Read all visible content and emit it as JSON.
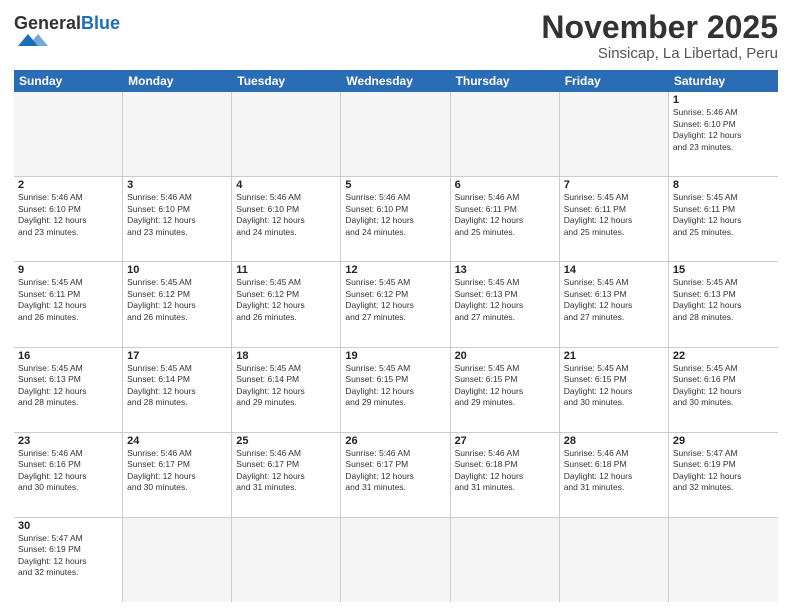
{
  "header": {
    "logo_general": "General",
    "logo_blue": "Blue",
    "month_title": "November 2025",
    "location": "Sinsicap, La Libertad, Peru"
  },
  "weekdays": [
    "Sunday",
    "Monday",
    "Tuesday",
    "Wednesday",
    "Thursday",
    "Friday",
    "Saturday"
  ],
  "weeks": [
    [
      {
        "day": "",
        "info": ""
      },
      {
        "day": "",
        "info": ""
      },
      {
        "day": "",
        "info": ""
      },
      {
        "day": "",
        "info": ""
      },
      {
        "day": "",
        "info": ""
      },
      {
        "day": "",
        "info": ""
      },
      {
        "day": "1",
        "info": "Sunrise: 5:46 AM\nSunset: 6:10 PM\nDaylight: 12 hours\nand 23 minutes."
      }
    ],
    [
      {
        "day": "2",
        "info": "Sunrise: 5:46 AM\nSunset: 6:10 PM\nDaylight: 12 hours\nand 23 minutes."
      },
      {
        "day": "3",
        "info": "Sunrise: 5:46 AM\nSunset: 6:10 PM\nDaylight: 12 hours\nand 23 minutes."
      },
      {
        "day": "4",
        "info": "Sunrise: 5:46 AM\nSunset: 6:10 PM\nDaylight: 12 hours\nand 24 minutes."
      },
      {
        "day": "5",
        "info": "Sunrise: 5:46 AM\nSunset: 6:10 PM\nDaylight: 12 hours\nand 24 minutes."
      },
      {
        "day": "6",
        "info": "Sunrise: 5:46 AM\nSunset: 6:11 PM\nDaylight: 12 hours\nand 25 minutes."
      },
      {
        "day": "7",
        "info": "Sunrise: 5:45 AM\nSunset: 6:11 PM\nDaylight: 12 hours\nand 25 minutes."
      },
      {
        "day": "8",
        "info": "Sunrise: 5:45 AM\nSunset: 6:11 PM\nDaylight: 12 hours\nand 25 minutes."
      }
    ],
    [
      {
        "day": "9",
        "info": "Sunrise: 5:45 AM\nSunset: 6:11 PM\nDaylight: 12 hours\nand 26 minutes."
      },
      {
        "day": "10",
        "info": "Sunrise: 5:45 AM\nSunset: 6:12 PM\nDaylight: 12 hours\nand 26 minutes."
      },
      {
        "day": "11",
        "info": "Sunrise: 5:45 AM\nSunset: 6:12 PM\nDaylight: 12 hours\nand 26 minutes."
      },
      {
        "day": "12",
        "info": "Sunrise: 5:45 AM\nSunset: 6:12 PM\nDaylight: 12 hours\nand 27 minutes."
      },
      {
        "day": "13",
        "info": "Sunrise: 5:45 AM\nSunset: 6:13 PM\nDaylight: 12 hours\nand 27 minutes."
      },
      {
        "day": "14",
        "info": "Sunrise: 5:45 AM\nSunset: 6:13 PM\nDaylight: 12 hours\nand 27 minutes."
      },
      {
        "day": "15",
        "info": "Sunrise: 5:45 AM\nSunset: 6:13 PM\nDaylight: 12 hours\nand 28 minutes."
      }
    ],
    [
      {
        "day": "16",
        "info": "Sunrise: 5:45 AM\nSunset: 6:13 PM\nDaylight: 12 hours\nand 28 minutes."
      },
      {
        "day": "17",
        "info": "Sunrise: 5:45 AM\nSunset: 6:14 PM\nDaylight: 12 hours\nand 28 minutes."
      },
      {
        "day": "18",
        "info": "Sunrise: 5:45 AM\nSunset: 6:14 PM\nDaylight: 12 hours\nand 29 minutes."
      },
      {
        "day": "19",
        "info": "Sunrise: 5:45 AM\nSunset: 6:15 PM\nDaylight: 12 hours\nand 29 minutes."
      },
      {
        "day": "20",
        "info": "Sunrise: 5:45 AM\nSunset: 6:15 PM\nDaylight: 12 hours\nand 29 minutes."
      },
      {
        "day": "21",
        "info": "Sunrise: 5:45 AM\nSunset: 6:15 PM\nDaylight: 12 hours\nand 30 minutes."
      },
      {
        "day": "22",
        "info": "Sunrise: 5:45 AM\nSunset: 6:16 PM\nDaylight: 12 hours\nand 30 minutes."
      }
    ],
    [
      {
        "day": "23",
        "info": "Sunrise: 5:46 AM\nSunset: 6:16 PM\nDaylight: 12 hours\nand 30 minutes."
      },
      {
        "day": "24",
        "info": "Sunrise: 5:46 AM\nSunset: 6:17 PM\nDaylight: 12 hours\nand 30 minutes."
      },
      {
        "day": "25",
        "info": "Sunrise: 5:46 AM\nSunset: 6:17 PM\nDaylight: 12 hours\nand 31 minutes."
      },
      {
        "day": "26",
        "info": "Sunrise: 5:46 AM\nSunset: 6:17 PM\nDaylight: 12 hours\nand 31 minutes."
      },
      {
        "day": "27",
        "info": "Sunrise: 5:46 AM\nSunset: 6:18 PM\nDaylight: 12 hours\nand 31 minutes."
      },
      {
        "day": "28",
        "info": "Sunrise: 5:46 AM\nSunset: 6:18 PM\nDaylight: 12 hours\nand 31 minutes."
      },
      {
        "day": "29",
        "info": "Sunrise: 5:47 AM\nSunset: 6:19 PM\nDaylight: 12 hours\nand 32 minutes."
      }
    ],
    [
      {
        "day": "30",
        "info": "Sunrise: 5:47 AM\nSunset: 6:19 PM\nDaylight: 12 hours\nand 32 minutes."
      },
      {
        "day": "",
        "info": ""
      },
      {
        "day": "",
        "info": ""
      },
      {
        "day": "",
        "info": ""
      },
      {
        "day": "",
        "info": ""
      },
      {
        "day": "",
        "info": ""
      },
      {
        "day": "",
        "info": ""
      }
    ]
  ]
}
